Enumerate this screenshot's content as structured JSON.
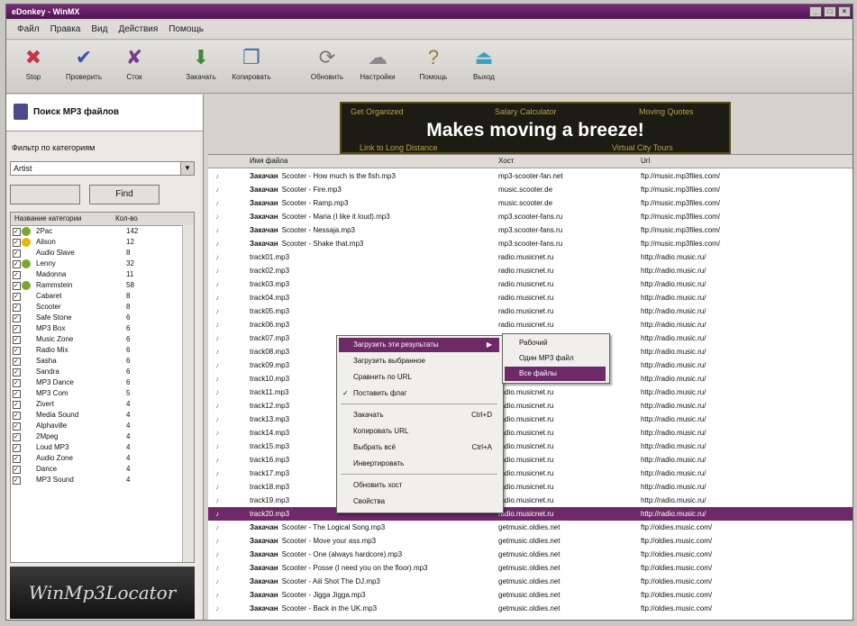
{
  "window": {
    "title": "eDonkey - WinMX"
  },
  "menubar": [
    "Файл",
    "Правка",
    "Вид",
    "Действия",
    "Помощь"
  ],
  "toolbar": [
    {
      "label": "Stop",
      "icon": "stop-icon",
      "color": "#c8334a"
    },
    {
      "label": "Проверить",
      "icon": "check-icon",
      "color": "#3a55a8"
    },
    {
      "label": "Сток",
      "icon": "uncheck-icon",
      "color": "#7a3b8f"
    },
    {
      "label": "Закачать",
      "icon": "download-icon",
      "color": "#3f8a3b"
    },
    {
      "label": "Копировать",
      "icon": "copy-icon",
      "color": "#4a6aa8"
    },
    {
      "label": "Обновить",
      "icon": "refresh-icon",
      "color": "#777777"
    },
    {
      "label": "Настройки",
      "icon": "settings-icon",
      "color": "#8a8a8a"
    },
    {
      "label": "Помощь",
      "icon": "help-icon",
      "color": "#9a7a30"
    },
    {
      "label": "Выход",
      "icon": "exit-icon",
      "color": "#3aa0c0"
    }
  ],
  "left": {
    "header": "Поиск MP3 файлов",
    "filter_label": "Фильтр по категориям",
    "filter_value": "Artist",
    "find_button": "Find",
    "col_name": "Название категории",
    "col_count": "Кол-во"
  },
  "categories": [
    {
      "name": "2Pac",
      "count": "142",
      "color": "#7aa82f"
    },
    {
      "name": "Alison",
      "count": "12",
      "color": "#e6b800"
    },
    {
      "name": "Audio Slave",
      "count": "8",
      "color": ""
    },
    {
      "name": "Lenny",
      "count": "32",
      "color": "#7aa82f"
    },
    {
      "name": "Madonna",
      "count": "11",
      "color": ""
    },
    {
      "name": "Rammstein",
      "count": "58",
      "color": "#7aa82f"
    },
    {
      "name": "Cabaret",
      "count": "8",
      "color": ""
    },
    {
      "name": "Scooter",
      "count": "8",
      "color": ""
    },
    {
      "name": "Safe Stone",
      "count": "6",
      "color": ""
    },
    {
      "name": "MP3 Box",
      "count": "6",
      "color": ""
    },
    {
      "name": "Music Zone",
      "count": "6",
      "color": ""
    },
    {
      "name": "Radio Mix",
      "count": "6",
      "color": ""
    },
    {
      "name": "Sasha",
      "count": "6",
      "color": ""
    },
    {
      "name": "Sandra",
      "count": "6",
      "color": ""
    },
    {
      "name": "MP3 Dance",
      "count": "6",
      "color": ""
    },
    {
      "name": "MP3 Com",
      "count": "5",
      "color": ""
    },
    {
      "name": "Zivert",
      "count": "4",
      "color": ""
    },
    {
      "name": "Media Sound",
      "count": "4",
      "color": ""
    },
    {
      "name": "Alphaville",
      "count": "4",
      "color": ""
    },
    {
      "name": "2Mpeg",
      "count": "4",
      "color": ""
    },
    {
      "name": "Loud MP3",
      "count": "4",
      "color": ""
    },
    {
      "name": "Audio Zone",
      "count": "4",
      "color": ""
    },
    {
      "name": "Dance",
      "count": "4",
      "color": ""
    },
    {
      "name": "MP3 Sound",
      "count": "4",
      "color": ""
    }
  ],
  "logo_text": "WinMp3Locator",
  "banner": {
    "main": "Makes moving a breeze!",
    "tl": "Get Organized",
    "tm": "Salary Calculator",
    "tr": "Moving Quotes",
    "bl": "Link to Long Distance",
    "br": "Virtual City Tours"
  },
  "file_columns": {
    "name": "Имя файла",
    "user": "Хост",
    "url": "Url"
  },
  "files": [
    {
      "status": "",
      "name": "Scooter - How much is the fish.mp3",
      "bold": "Закачан",
      "user": "mp3-scooter-fan.net",
      "url": "ftp://music.mp3files.com/"
    },
    {
      "status": "",
      "name": "Scooter - Fire.mp3",
      "bold": "Закачан",
      "user": "music.scooter.de",
      "url": "ftp://music.mp3files.com/"
    },
    {
      "status": "",
      "name": "Scooter - Ramp.mp3",
      "bold": "Закачан",
      "user": "music.scooter.de",
      "url": "ftp://music.mp3files.com/"
    },
    {
      "status": "",
      "name": "Scooter - Maria (I like it loud).mp3",
      "bold": "Закачан",
      "user": "mp3.scooter-fans.ru",
      "url": "ftp://music.mp3files.com/"
    },
    {
      "status": "",
      "name": "Scooter - Nessaja.mp3",
      "bold": "Закачан",
      "user": "mp3.scooter-fans.ru",
      "url": "ftp://music.mp3files.com/"
    },
    {
      "status": "",
      "name": "Scooter - Shake that.mp3",
      "bold": "Закачан",
      "user": "mp3.scooter-fans.ru",
      "url": "ftp://music.mp3files.com/"
    },
    {
      "status": "",
      "name": "track01.mp3",
      "bold": "",
      "user": "radio.musicnet.ru",
      "url": "http://radio.music.ru/"
    },
    {
      "status": "",
      "name": "track02.mp3",
      "bold": "",
      "user": "radio.musicnet.ru",
      "url": "http://radio.music.ru/"
    },
    {
      "status": "",
      "name": "track03.mp3",
      "bold": "",
      "user": "radio.musicnet.ru",
      "url": "http://radio.music.ru/"
    },
    {
      "status": "",
      "name": "track04.mp3",
      "bold": "",
      "user": "radio.musicnet.ru",
      "url": "http://radio.music.ru/"
    },
    {
      "status": "",
      "name": "track05.mp3",
      "bold": "",
      "user": "radio.musicnet.ru",
      "url": "http://radio.music.ru/"
    },
    {
      "status": "",
      "name": "track06.mp3",
      "bold": "",
      "user": "radio.musicnet.ru",
      "url": "http://radio.music.ru/"
    },
    {
      "status": "",
      "name": "track07.mp3",
      "bold": "",
      "user": "radio.musicnet.ru",
      "url": "http://radio.music.ru/"
    },
    {
      "status": "",
      "name": "track08.mp3",
      "bold": "",
      "user": "radio.musicnet.ru",
      "url": "http://radio.music.ru/"
    },
    {
      "status": "",
      "name": "track09.mp3",
      "bold": "",
      "user": "radio.musicnet.ru",
      "url": "http://radio.music.ru/"
    },
    {
      "status": "",
      "name": "track10.mp3",
      "bold": "",
      "user": "radio.musicnet.ru",
      "url": "http://radio.music.ru/"
    },
    {
      "status": "",
      "name": "track11.mp3",
      "bold": "",
      "user": "radio.musicnet.ru",
      "url": "http://radio.music.ru/"
    },
    {
      "status": "",
      "name": "track12.mp3",
      "bold": "",
      "user": "radio.musicnet.ru",
      "url": "http://radio.music.ru/"
    },
    {
      "status": "",
      "name": "track13.mp3",
      "bold": "",
      "user": "radio.musicnet.ru",
      "url": "http://radio.music.ru/"
    },
    {
      "status": "",
      "name": "track14.mp3",
      "bold": "",
      "user": "radio.musicnet.ru",
      "url": "http://radio.music.ru/"
    },
    {
      "status": "",
      "name": "track15.mp3",
      "bold": "",
      "user": "radio.musicnet.ru",
      "url": "http://radio.music.ru/"
    },
    {
      "status": "",
      "name": "track16.mp3",
      "bold": "",
      "user": "radio.musicnet.ru",
      "url": "http://radio.music.ru/"
    },
    {
      "status": "",
      "name": "track17.mp3",
      "bold": "",
      "user": "radio.musicnet.ru",
      "url": "http://radio.music.ru/"
    },
    {
      "status": "",
      "name": "track18.mp3",
      "bold": "",
      "user": "radio.musicnet.ru",
      "url": "http://radio.music.ru/"
    },
    {
      "status": "",
      "name": "track19.mp3",
      "bold": "",
      "user": "radio.musicnet.ru",
      "url": "http://radio.music.ru/"
    },
    {
      "status": "",
      "name": "track20.mp3",
      "bold": "",
      "user": "radio.musicnet.ru",
      "url": "http://radio.music.ru/"
    },
    {
      "status": "",
      "name": "Scooter - The Logical Song.mp3",
      "bold": "Закачан",
      "user": "getmusic.oldies.net",
      "url": "ftp://oldies.music.com/"
    },
    {
      "status": "",
      "name": "Scooter - Move your ass.mp3",
      "bold": "Закачан",
      "user": "getmusic.oldies.net",
      "url": "ftp://oldies.music.com/"
    },
    {
      "status": "",
      "name": "Scooter - One (always hardcore).mp3",
      "bold": "Закачан",
      "user": "getmusic.oldies.net",
      "url": "ftp://oldies.music.com/"
    },
    {
      "status": "",
      "name": "Scooter - Posse (I need you on the floor).mp3",
      "bold": "Закачан",
      "user": "getmusic.oldies.net",
      "url": "ftp://oldies.music.com/"
    },
    {
      "status": "",
      "name": "Scooter - Aiii Shot The DJ.mp3",
      "bold": "Закачан",
      "user": "getmusic.oldies.net",
      "url": "ftp://oldies.music.com/"
    },
    {
      "status": "",
      "name": "Scooter - Jigga Jigga.mp3",
      "bold": "Закачан",
      "user": "getmusic.oldies.net",
      "url": "ftp://oldies.music.com/"
    },
    {
      "status": "",
      "name": "Scooter - Back in the UK.mp3",
      "bold": "Закачан",
      "user": "getmusic.oldies.net",
      "url": "ftp://oldies.music.com/"
    }
  ],
  "context_menu": [
    {
      "label": "Загрузить эти результаты",
      "shortcut": "",
      "highlight": true,
      "check": ""
    },
    {
      "label": "Загрузить выбранное",
      "shortcut": "",
      "highlight": false,
      "check": ""
    },
    {
      "label": "Сравнить по URL",
      "shortcut": "",
      "highlight": false,
      "check": ""
    },
    {
      "label": "Поставить флаг",
      "shortcut": "",
      "highlight": false,
      "check": "✓"
    },
    {
      "label": "Закачать",
      "shortcut": "Ctrl+D",
      "highlight": false,
      "check": ""
    },
    {
      "label": "Копировать URL",
      "shortcut": "",
      "highlight": false,
      "check": ""
    },
    {
      "label": "Выбрать всё",
      "shortcut": "Ctrl+A",
      "highlight": false,
      "check": ""
    },
    {
      "label": "Инвертировать",
      "shortcut": "",
      "highlight": false,
      "check": ""
    },
    {
      "label": "Обновить хост",
      "shortcut": "",
      "highlight": false,
      "check": ""
    },
    {
      "label": "Свойства",
      "shortcut": "",
      "highlight": false,
      "check": ""
    }
  ],
  "submenu": [
    {
      "label": "Рабочий",
      "highlight": false
    },
    {
      "label": "Один MP3 файл",
      "highlight": false
    },
    {
      "label": "Все файлы",
      "highlight": true
    }
  ]
}
